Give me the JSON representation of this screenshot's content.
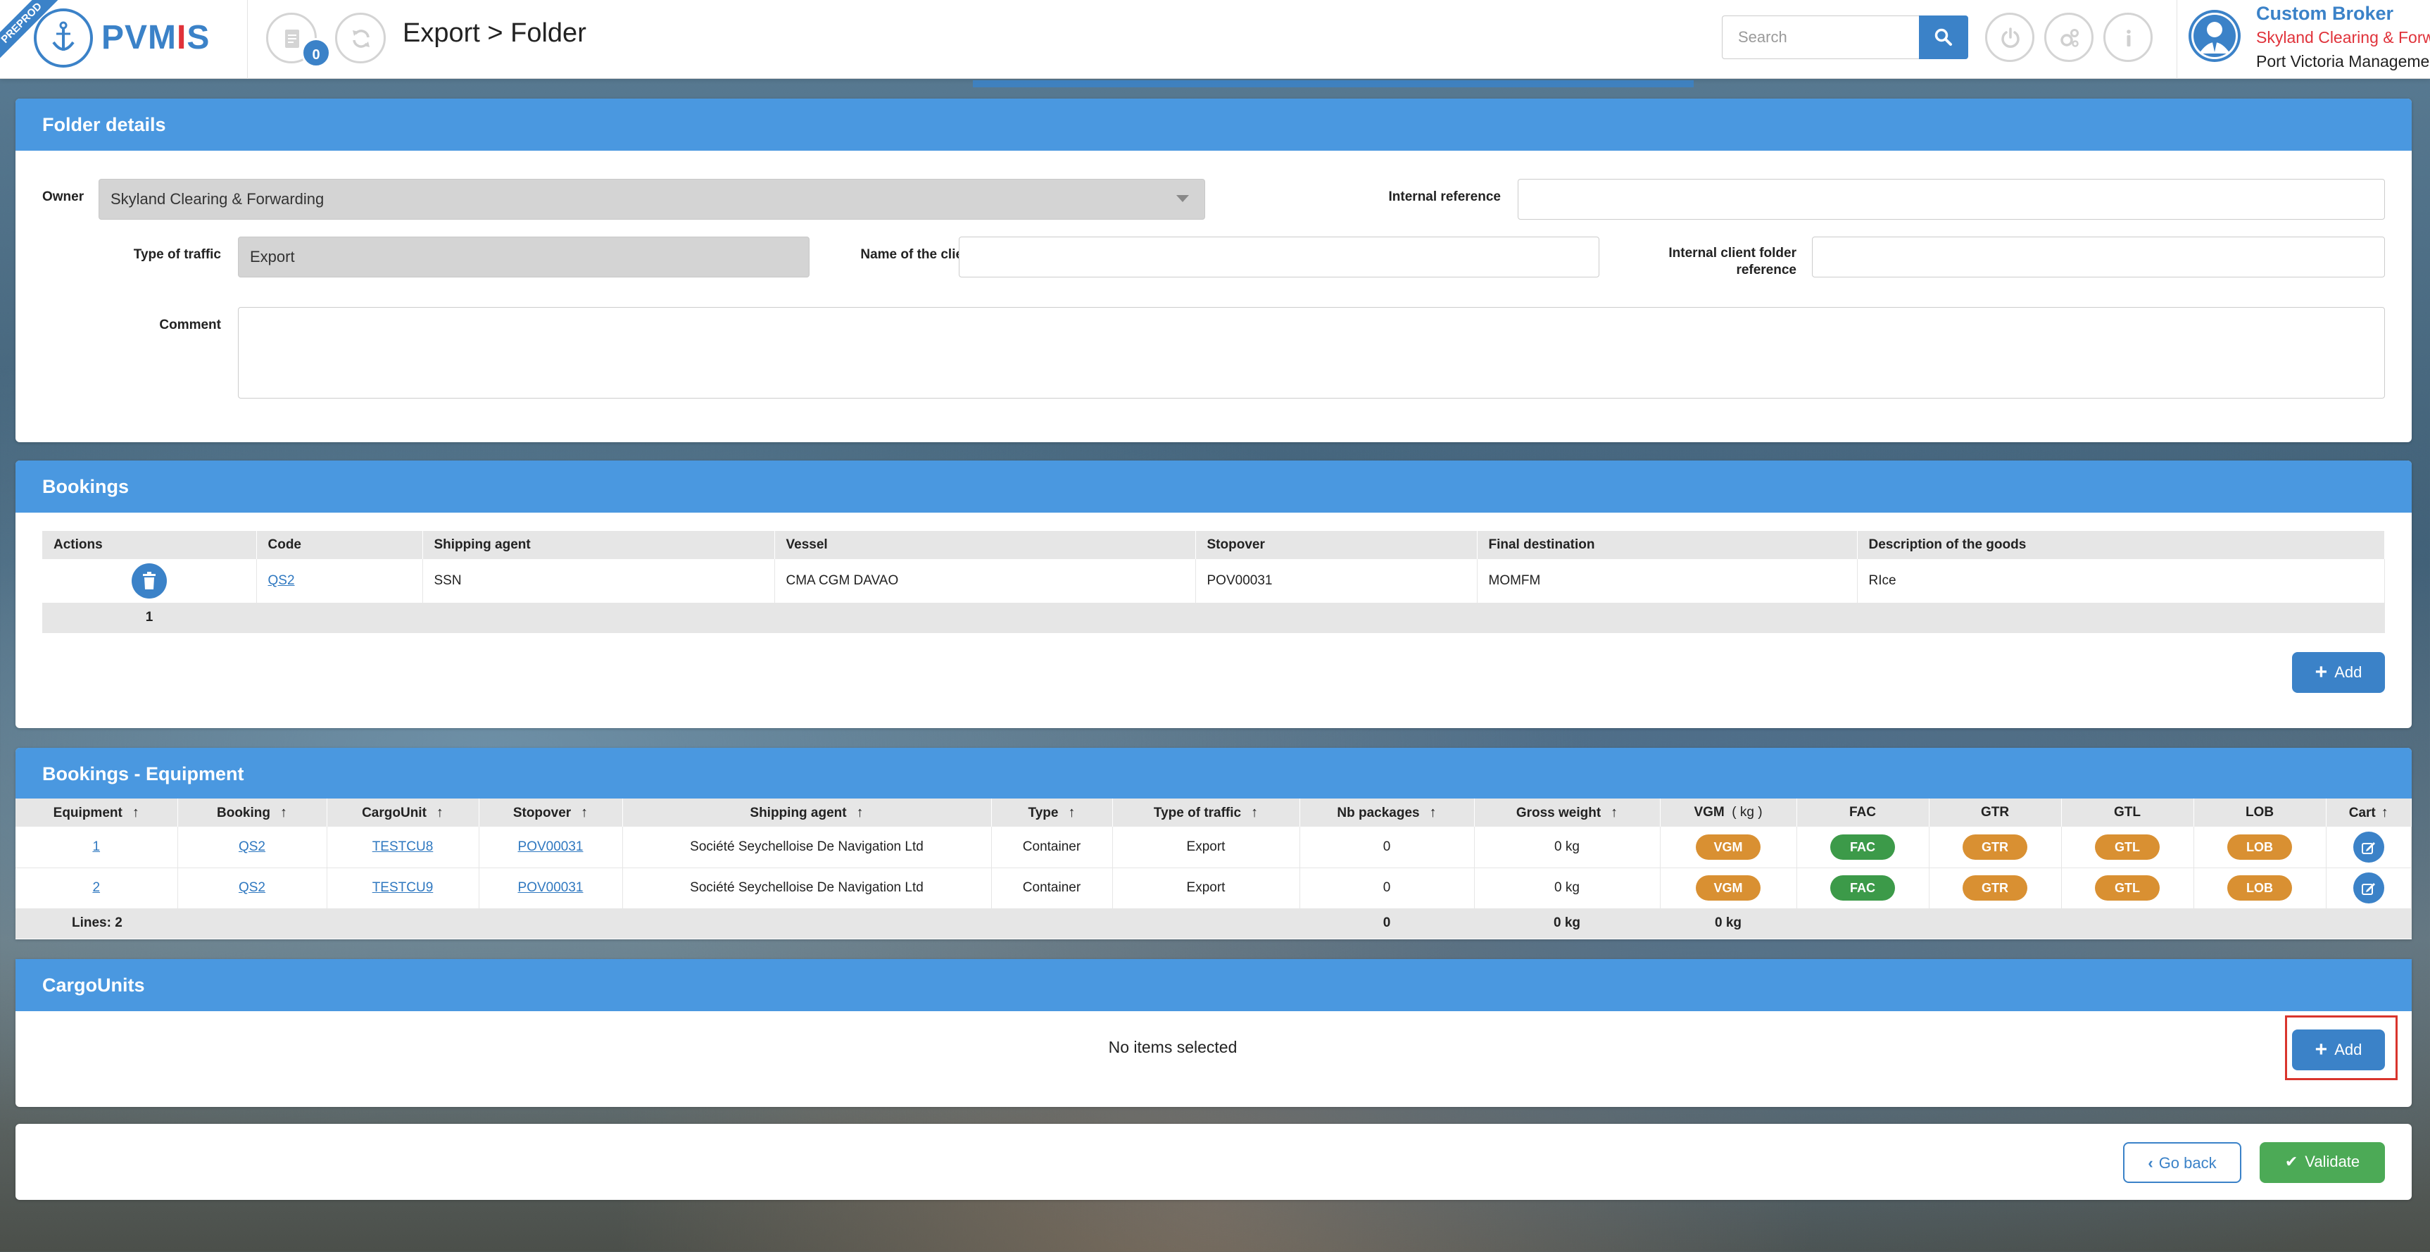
{
  "header": {
    "ribbon": "PREPROD",
    "logo_text_a": "PVM",
    "logo_text_bar": "I",
    "logo_text_b": "S",
    "badge_count": "0",
    "page_title": "Export > Folder",
    "search_placeholder": "Search",
    "user_role": "Custom Broker",
    "user_org": "Skyland Clearing & Forwarding",
    "user_port": "Port Victoria Management"
  },
  "folder_details": {
    "title": "Folder details",
    "owner_label": "Owner",
    "owner_value": "Skyland Clearing & Forwarding",
    "internal_reference_label": "Internal reference",
    "internal_reference_value": "",
    "type_of_traffic_label": "Type of traffic",
    "type_of_traffic_value": "Export",
    "name_of_client_label": "Name of the client",
    "name_of_client_value": "",
    "internal_client_folder_label": "Internal client folder reference",
    "internal_client_folder_value": "",
    "comment_label": "Comment",
    "comment_value": ""
  },
  "bookings": {
    "title": "Bookings",
    "columns": [
      "Actions",
      "Code",
      "Shipping agent",
      "Vessel",
      "Stopover",
      "Final destination",
      "Description of the goods"
    ],
    "rows": [
      {
        "code": "QS2",
        "shipping_agent": "SSN",
        "vessel": "CMA CGM DAVAO",
        "stopover": "POV00031",
        "final_destination": "MOMFM",
        "description": "RIce"
      }
    ],
    "footer_count": "1",
    "add_label": "Add"
  },
  "equipment": {
    "title": "Bookings - Equipment",
    "columns": [
      "Equipment",
      "Booking",
      "CargoUnit",
      "Stopover",
      "Shipping agent",
      "Type",
      "Type of traffic",
      "Nb packages",
      "Gross weight",
      "VGM",
      "( kg )",
      "FAC",
      "GTR",
      "GTL",
      "LOB",
      "Cart"
    ],
    "rows": [
      {
        "equipment": "1",
        "booking": "QS2",
        "cargo_unit": "TESTCU8",
        "stopover": "POV00031",
        "shipping_agent": "Société Seychelloise De Navigation Ltd",
        "type": "Container",
        "traffic": "Export",
        "nb_packages": "0",
        "gross_weight": "0 kg",
        "vgm": "VGM",
        "fac": "FAC",
        "gtr": "GTR",
        "gtl": "GTL",
        "lob": "LOB"
      },
      {
        "equipment": "2",
        "booking": "QS2",
        "cargo_unit": "TESTCU9",
        "stopover": "POV00031",
        "shipping_agent": "Société Seychelloise De Navigation Ltd",
        "type": "Container",
        "traffic": "Export",
        "nb_packages": "0",
        "gross_weight": "0 kg",
        "vgm": "VGM",
        "fac": "FAC",
        "gtr": "GTR",
        "gtl": "GTL",
        "lob": "LOB"
      }
    ],
    "footer": {
      "lines": "Lines: 2",
      "nb_packages": "0",
      "gross_weight": "0 kg",
      "vgm": "0 kg"
    }
  },
  "cargo_units": {
    "title": "CargoUnits",
    "empty_text": "No items selected",
    "add_label": "Add"
  },
  "footer": {
    "go_back_label": "Go back",
    "validate_label": "Validate"
  },
  "colors": {
    "primary": "#3b82c8",
    "panel_header": "#4a98e0",
    "accent_red": "#e0323a",
    "pill_orange": "#d99032",
    "pill_green": "#3c9a49",
    "validate_green": "#4caa56"
  }
}
